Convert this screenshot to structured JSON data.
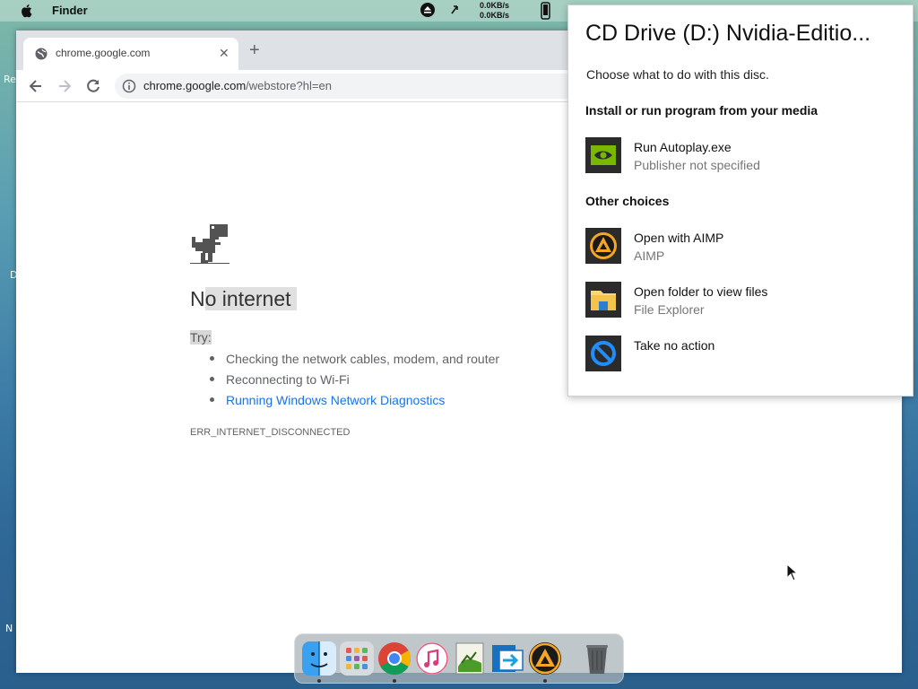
{
  "menubar": {
    "app_name": "Finder",
    "net_up": "0.0KB/s",
    "net_down": "0.0KB/s"
  },
  "desktop_edge": {
    "label_1": "Re",
    "label_2": "D",
    "label_3": "N"
  },
  "browser": {
    "tab_title": "chrome.google.com",
    "new_tab_label": "+",
    "url_host": "chrome.google.com",
    "url_path": "/webstore?hl=en"
  },
  "error_page": {
    "title_first": "N",
    "title_rest": "o internet",
    "try_label": "Try:",
    "suggestions": [
      "Checking the network cables, modem, and router",
      "Reconnecting to Wi-Fi",
      "Running Windows Network Diagnostics"
    ],
    "error_code": "ERR_INTERNET_DISCONNECTED"
  },
  "autoplay": {
    "title": "CD Drive (D:) Nvidia-Editio...",
    "subtitle": "Choose what to do with this disc.",
    "section_install": "Install or run program from your media",
    "section_other": "Other choices",
    "options": [
      {
        "label": "Run Autoplay.exe",
        "desc": "Publisher not specified",
        "icon": "nvidia-icon"
      },
      {
        "label": "Open with AIMP",
        "desc": "AIMP",
        "icon": "aimp-icon"
      },
      {
        "label": "Open folder to view files",
        "desc": "File Explorer",
        "icon": "folder-icon"
      },
      {
        "label": "Take no action",
        "desc": "",
        "icon": "no-action-icon"
      }
    ]
  },
  "dock": {
    "items": [
      "finder-icon",
      "launchpad-icon",
      "chrome-icon",
      "itunes-icon",
      "app-installer-icon",
      "migration-icon",
      "aimp-icon",
      "trash-icon"
    ]
  },
  "colors": {
    "link_blue": "#1a73e8",
    "autoplay_gray_text": "#767676",
    "nvidia_green": "#76b900",
    "aimp_orange": "#f5a623"
  }
}
